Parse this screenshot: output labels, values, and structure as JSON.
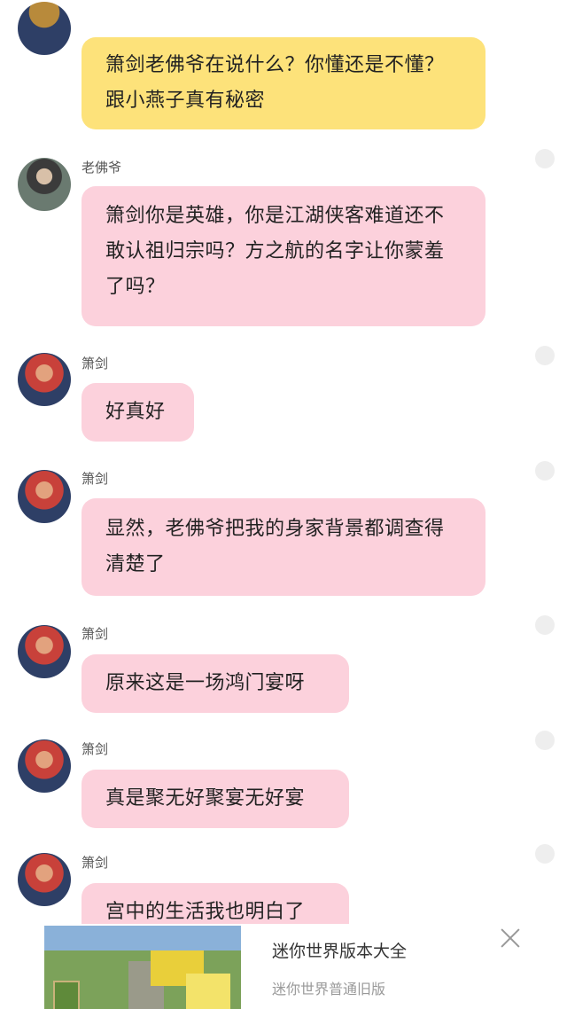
{
  "messages": [
    {
      "sender": "",
      "text": "箫剑老佛爷在说什么？你懂还是不懂？跟小燕子真有秘密"
    },
    {
      "sender": "老佛爷",
      "text": "箫剑你是英雄，你是江湖侠客难道还不敢认祖归宗吗？方之航的名字让你蒙羞了吗？"
    },
    {
      "sender": "箫剑",
      "text": "好真好"
    },
    {
      "sender": "箫剑",
      "text": "显然，老佛爷把我的身家背景都调查得清楚了"
    },
    {
      "sender": "箫剑",
      "text": "原来这是一场鸿门宴呀"
    },
    {
      "sender": "箫剑",
      "text": "真是聚无好聚宴无好宴"
    },
    {
      "sender": "箫剑",
      "text": "宫中的生活我也明白了"
    }
  ],
  "ad": {
    "title": "迷你世界版本大全",
    "subtitle": "迷你世界普通旧版"
  }
}
